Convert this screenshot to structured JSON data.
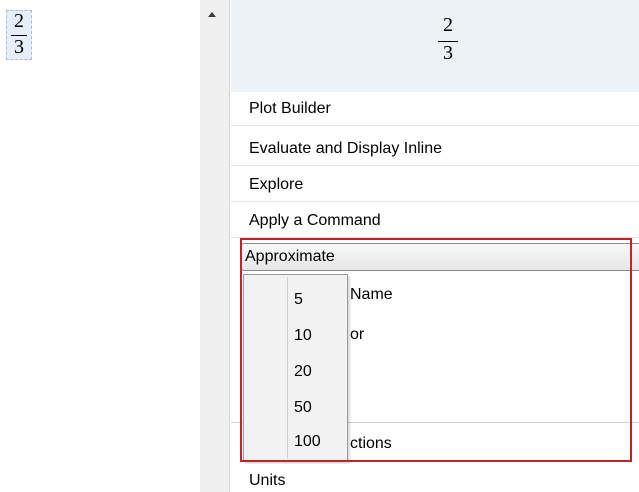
{
  "document": {
    "fraction": {
      "numerator": "2",
      "denominator": "3"
    }
  },
  "preview": {
    "fraction": {
      "numerator": "2",
      "denominator": "3"
    }
  },
  "menu": {
    "items": [
      {
        "label": "Plot Builder"
      },
      {
        "label": "Evaluate and Display Inline"
      },
      {
        "label": "Explore"
      },
      {
        "label": "Apply a Command"
      }
    ],
    "approximate": {
      "label": "Approximate"
    },
    "partially_hidden": {
      "name_fragment": "Name",
      "or_fragment": "or",
      "ctions_fragment": "ctions"
    },
    "units": {
      "label": "Units"
    }
  },
  "submenu": {
    "options": [
      "5",
      "10",
      "20",
      "50",
      "100"
    ]
  },
  "colors": {
    "highlight": "#c0232c",
    "preview_bg": "#edf2f7"
  }
}
